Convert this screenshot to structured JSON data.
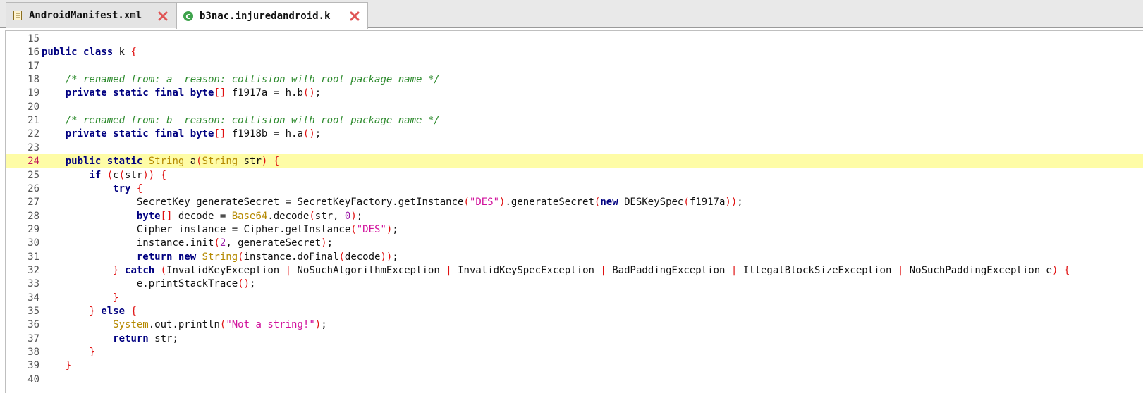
{
  "tabs": [
    {
      "label": "AndroidManifest.xml",
      "icon": "xml-file-icon",
      "active": false
    },
    {
      "label": "b3nac.injuredandroid.k",
      "icon": "java-class-icon",
      "active": true
    }
  ],
  "editor": {
    "current_line": 24,
    "lines": [
      {
        "n": "15",
        "t": [
          [
            "pl",
            "    "
          ]
        ]
      },
      {
        "n": "16",
        "t": [
          [
            "kw",
            "public class "
          ],
          [
            "pl",
            "k "
          ],
          [
            "br",
            "{"
          ]
        ]
      },
      {
        "n": "17",
        "t": []
      },
      {
        "n": "18",
        "t": [
          [
            "pl",
            "    "
          ],
          [
            "com",
            "/* renamed from: a  reason: collision with root package name */"
          ]
        ]
      },
      {
        "n": "19",
        "t": [
          [
            "pl",
            "    "
          ],
          [
            "kw",
            "private static final "
          ],
          [
            "ty",
            "byte"
          ],
          [
            "br",
            "[]"
          ],
          [
            "pl",
            " f1917a = h.b"
          ],
          [
            "br",
            "()"
          ],
          [
            "pl",
            ";"
          ]
        ]
      },
      {
        "n": "20",
        "t": []
      },
      {
        "n": "21",
        "t": [
          [
            "pl",
            "    "
          ],
          [
            "com",
            "/* renamed from: b  reason: collision with root package name */"
          ]
        ]
      },
      {
        "n": "22",
        "t": [
          [
            "pl",
            "    "
          ],
          [
            "kw",
            "private static final "
          ],
          [
            "ty",
            "byte"
          ],
          [
            "br",
            "[]"
          ],
          [
            "pl",
            " f1918b = h.a"
          ],
          [
            "br",
            "()"
          ],
          [
            "pl",
            ";"
          ]
        ]
      },
      {
        "n": "23",
        "t": []
      },
      {
        "n": "24",
        "t": [
          [
            "pl",
            "    "
          ],
          [
            "kw",
            "public static "
          ],
          [
            "cls",
            "String"
          ],
          [
            "pl",
            " a"
          ],
          [
            "br",
            "("
          ],
          [
            "cls",
            "String"
          ],
          [
            "pl",
            " str"
          ],
          [
            "br",
            ")"
          ],
          [
            "pl",
            " "
          ],
          [
            "br",
            "{"
          ]
        ]
      },
      {
        "n": "25",
        "t": [
          [
            "pl",
            "        "
          ],
          [
            "kw",
            "if "
          ],
          [
            "br",
            "("
          ],
          [
            "pl",
            "c"
          ],
          [
            "br",
            "("
          ],
          [
            "pl",
            "str"
          ],
          [
            "br",
            "))"
          ],
          [
            "pl",
            " "
          ],
          [
            "br",
            "{"
          ]
        ]
      },
      {
        "n": "26",
        "t": [
          [
            "pl",
            "            "
          ],
          [
            "kw",
            "try "
          ],
          [
            "br",
            "{"
          ]
        ]
      },
      {
        "n": "27",
        "t": [
          [
            "pl",
            "                SecretKey generateSecret = SecretKeyFactory.getInstance"
          ],
          [
            "br",
            "("
          ],
          [
            "str",
            "\"DES\""
          ],
          [
            "br",
            ")"
          ],
          [
            "pl",
            ".generateSecret"
          ],
          [
            "br",
            "("
          ],
          [
            "kw",
            "new "
          ],
          [
            "pl",
            "DESKeySpec"
          ],
          [
            "br",
            "("
          ],
          [
            "pl",
            "f1917a"
          ],
          [
            "br",
            "))"
          ],
          [
            "pl",
            ";"
          ]
        ]
      },
      {
        "n": "28",
        "t": [
          [
            "pl",
            "                "
          ],
          [
            "ty",
            "byte"
          ],
          [
            "br",
            "[]"
          ],
          [
            "pl",
            " decode = "
          ],
          [
            "cls",
            "Base64"
          ],
          [
            "pl",
            ".decode"
          ],
          [
            "br",
            "("
          ],
          [
            "pl",
            "str, "
          ],
          [
            "num",
            "0"
          ],
          [
            "br",
            ")"
          ],
          [
            "pl",
            ";"
          ]
        ]
      },
      {
        "n": "29",
        "t": [
          [
            "pl",
            "                Cipher instance = Cipher.getInstance"
          ],
          [
            "br",
            "("
          ],
          [
            "str",
            "\"DES\""
          ],
          [
            "br",
            ")"
          ],
          [
            "pl",
            ";"
          ]
        ]
      },
      {
        "n": "30",
        "t": [
          [
            "pl",
            "                instance.init"
          ],
          [
            "br",
            "("
          ],
          [
            "num",
            "2"
          ],
          [
            "pl",
            ", generateSecret"
          ],
          [
            "br",
            ")"
          ],
          [
            "pl",
            ";"
          ]
        ]
      },
      {
        "n": "31",
        "t": [
          [
            "pl",
            "                "
          ],
          [
            "kw",
            "return new "
          ],
          [
            "cls",
            "String"
          ],
          [
            "br",
            "("
          ],
          [
            "pl",
            "instance.doFinal"
          ],
          [
            "br",
            "("
          ],
          [
            "pl",
            "decode"
          ],
          [
            "br",
            "))"
          ],
          [
            "pl",
            ";"
          ]
        ]
      },
      {
        "n": "32",
        "t": [
          [
            "pl",
            "            "
          ],
          [
            "br",
            "}"
          ],
          [
            "pl",
            " "
          ],
          [
            "kw",
            "catch "
          ],
          [
            "br",
            "("
          ],
          [
            "pl",
            "InvalidKeyException "
          ],
          [
            "br",
            "|"
          ],
          [
            "pl",
            " NoSuchAlgorithmException "
          ],
          [
            "br",
            "|"
          ],
          [
            "pl",
            " InvalidKeySpecException "
          ],
          [
            "br",
            "|"
          ],
          [
            "pl",
            " BadPaddingException "
          ],
          [
            "br",
            "|"
          ],
          [
            "pl",
            " IllegalBlockSizeException "
          ],
          [
            "br",
            "|"
          ],
          [
            "pl",
            " NoSuchPaddingException e"
          ],
          [
            "br",
            ")"
          ],
          [
            "pl",
            " "
          ],
          [
            "br",
            "{"
          ]
        ]
      },
      {
        "n": "33",
        "t": [
          [
            "pl",
            "                e.printStackTrace"
          ],
          [
            "br",
            "()"
          ],
          [
            "pl",
            ";"
          ]
        ]
      },
      {
        "n": "34",
        "t": [
          [
            "pl",
            "            "
          ],
          [
            "br",
            "}"
          ]
        ]
      },
      {
        "n": "35",
        "t": [
          [
            "pl",
            "        "
          ],
          [
            "br",
            "}"
          ],
          [
            "pl",
            " "
          ],
          [
            "kw",
            "else "
          ],
          [
            "br",
            "{"
          ]
        ]
      },
      {
        "n": "36",
        "t": [
          [
            "pl",
            "            "
          ],
          [
            "cls",
            "System"
          ],
          [
            "pl",
            ".out.println"
          ],
          [
            "br",
            "("
          ],
          [
            "str",
            "\"Not a string!\""
          ],
          [
            "br",
            ")"
          ],
          [
            "pl",
            ";"
          ]
        ]
      },
      {
        "n": "37",
        "t": [
          [
            "pl",
            "            "
          ],
          [
            "kw",
            "return "
          ],
          [
            "pl",
            "str;"
          ]
        ]
      },
      {
        "n": "38",
        "t": [
          [
            "pl",
            "        "
          ],
          [
            "br",
            "}"
          ]
        ]
      },
      {
        "n": "39",
        "t": [
          [
            "pl",
            "    "
          ],
          [
            "br",
            "}"
          ]
        ]
      },
      {
        "n": "40",
        "t": []
      }
    ]
  }
}
